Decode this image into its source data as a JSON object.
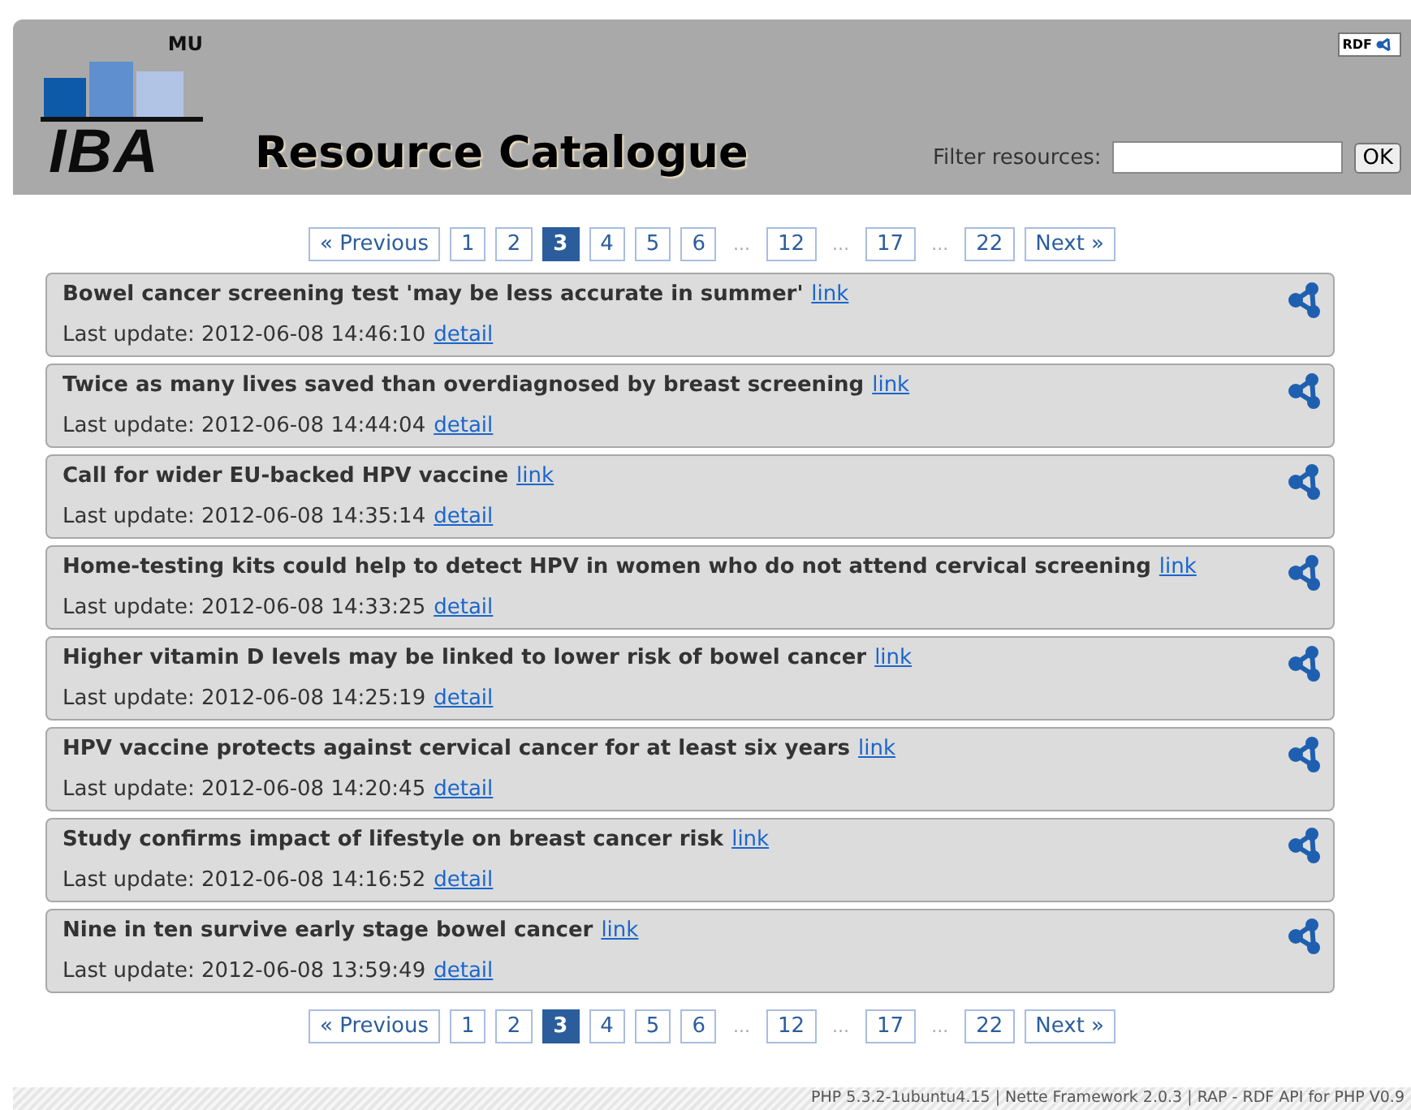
{
  "header": {
    "logo_top": "MU",
    "logo_text": "IBA",
    "title": "Resource Catalogue",
    "rdf_badge": "RDF",
    "filter": {
      "label": "Filter resources:",
      "button": "OK"
    }
  },
  "pagination_top": [
    {
      "kind": "nav",
      "label": "« Previous"
    },
    {
      "kind": "page",
      "label": "1",
      "selected": false
    },
    {
      "kind": "page",
      "label": "2",
      "selected": false
    },
    {
      "kind": "page",
      "label": "3",
      "selected": true
    },
    {
      "kind": "page",
      "label": "4",
      "selected": false
    },
    {
      "kind": "page",
      "label": "5",
      "selected": false
    },
    {
      "kind": "page",
      "label": "6",
      "selected": false
    },
    {
      "kind": "gap",
      "label": "..."
    },
    {
      "kind": "page",
      "label": "12",
      "selected": false
    },
    {
      "kind": "gap",
      "label": "..."
    },
    {
      "kind": "page",
      "label": "17",
      "selected": false
    },
    {
      "kind": "gap",
      "label": "..."
    },
    {
      "kind": "page",
      "label": "22",
      "selected": false
    },
    {
      "kind": "nav",
      "label": "Next »"
    }
  ],
  "resources": [
    {
      "title": "Bowel cancer screening test 'may be less accurate in summer'",
      "link": "link",
      "updated": "Last update: 2012-06-08 14:46:10",
      "detail": "detail"
    },
    {
      "title": "Twice as many lives saved than overdiagnosed by breast screening",
      "link": "link",
      "updated": "Last update: 2012-06-08 14:44:04",
      "detail": "detail"
    },
    {
      "title": "Call for wider EU-backed HPV vaccine",
      "link": "link",
      "updated": "Last update: 2012-06-08 14:35:14",
      "detail": "detail"
    },
    {
      "title": "Home-testing kits could help to detect HPV in women who do not attend cervical screening",
      "link": "link",
      "updated": "Last update: 2012-06-08 14:33:25",
      "detail": "detail"
    },
    {
      "title": "Higher vitamin D levels may be linked to lower risk of bowel cancer",
      "link": "link",
      "updated": "Last update: 2012-06-08 14:25:19",
      "detail": "detail"
    },
    {
      "title": "HPV vaccine protects against cervical cancer for at least six years",
      "link": "link",
      "updated": "Last update: 2012-06-08 14:20:45",
      "detail": "detail"
    },
    {
      "title": "Study confirms impact of lifestyle on breast cancer risk",
      "link": "link",
      "updated": "Last update: 2012-06-08 14:16:52",
      "detail": "detail"
    },
    {
      "title": "Nine in ten survive early stage bowel cancer",
      "link": "link",
      "updated": "Last update: 2012-06-08 13:59:49",
      "detail": "detail"
    }
  ],
  "pagination_bottom": [
    {
      "kind": "nav",
      "label": "« Previous"
    },
    {
      "kind": "page",
      "label": "1",
      "selected": false
    },
    {
      "kind": "page",
      "label": "2",
      "selected": false
    },
    {
      "kind": "page",
      "label": "3",
      "selected": true
    },
    {
      "kind": "page",
      "label": "4",
      "selected": false
    },
    {
      "kind": "page",
      "label": "5",
      "selected": false
    },
    {
      "kind": "page",
      "label": "6",
      "selected": false
    },
    {
      "kind": "gap",
      "label": "..."
    },
    {
      "kind": "page",
      "label": "12",
      "selected": false
    },
    {
      "kind": "gap",
      "label": "..."
    },
    {
      "kind": "page",
      "label": "17",
      "selected": false
    },
    {
      "kind": "gap",
      "label": "..."
    },
    {
      "kind": "page",
      "label": "22",
      "selected": false
    },
    {
      "kind": "nav",
      "label": "Next »"
    }
  ],
  "footer": "PHP 5.3.2-1ubuntu4.15 | Nette Framework 2.0.3 | RAP - RDF API for PHP V0.9"
}
